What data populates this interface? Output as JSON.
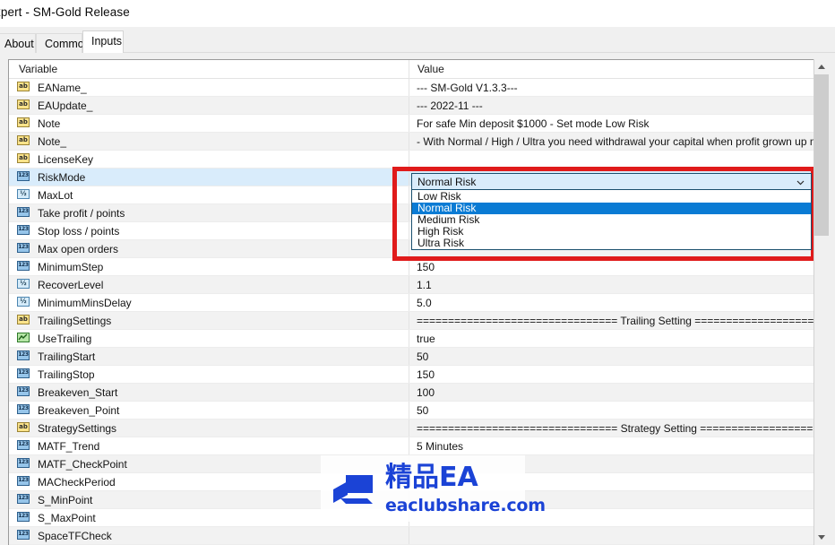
{
  "window": {
    "title": "xpert - SM-Gold Release"
  },
  "tabs": [
    {
      "label": "About",
      "active": false
    },
    {
      "label": "Common",
      "active": false
    },
    {
      "label": "Inputs",
      "active": true
    }
  ],
  "grid": {
    "columns": {
      "variable": "Variable",
      "value": "Value"
    },
    "rows": [
      {
        "icon": "string-icon",
        "type": "str",
        "name": "EAName_",
        "value": "--- SM-Gold V1.3.3---",
        "style": "plain"
      },
      {
        "icon": "string-icon",
        "type": "str",
        "name": "EAUpdate_",
        "value": "--- 2022-11 ---",
        "style": "alt"
      },
      {
        "icon": "string-icon",
        "type": "str",
        "name": "Note",
        "value": "For safe Min deposit $1000 - Set mode Low Risk",
        "style": "plain"
      },
      {
        "icon": "string-icon",
        "type": "str",
        "name": "Note_",
        "value": "- With Normal / High / Ultra you need withdrawal your capital when profit grown up more tha...",
        "style": "alt"
      },
      {
        "icon": "string-icon",
        "type": "str",
        "name": "LicenseKey",
        "value": "",
        "style": "plain"
      },
      {
        "icon": "int-icon",
        "type": "int",
        "name": "RiskMode",
        "value": "",
        "style": "selected"
      },
      {
        "icon": "double-icon",
        "type": "dbl",
        "name": "MaxLot",
        "value": "",
        "style": "plain"
      },
      {
        "icon": "int-icon",
        "type": "int",
        "name": "Take profit / points",
        "value": "",
        "style": "alt"
      },
      {
        "icon": "int-icon",
        "type": "int",
        "name": "Stop loss / points",
        "value": "",
        "style": "plain"
      },
      {
        "icon": "int-icon",
        "type": "int",
        "name": "Max open orders",
        "value": "",
        "style": "alt"
      },
      {
        "icon": "int-icon",
        "type": "int",
        "name": "MinimumStep",
        "value": "150",
        "style": "plain"
      },
      {
        "icon": "double-icon",
        "type": "dbl",
        "name": "RecoverLevel",
        "value": "1.1",
        "style": "alt"
      },
      {
        "icon": "double-icon",
        "type": "dbl",
        "name": "MinimumMinsDelay",
        "value": "5.0",
        "style": "plain"
      },
      {
        "icon": "string-icon",
        "type": "str",
        "name": "TrailingSettings",
        "value": "================================ Trailing Setting ==============================...",
        "style": "alt"
      },
      {
        "icon": "bool-icon",
        "type": "bool",
        "name": "UseTrailing",
        "value": "true",
        "style": "plain"
      },
      {
        "icon": "int-icon",
        "type": "int",
        "name": "TrailingStart",
        "value": "50",
        "style": "alt"
      },
      {
        "icon": "int-icon",
        "type": "int",
        "name": "TrailingStop",
        "value": "150",
        "style": "plain"
      },
      {
        "icon": "int-icon",
        "type": "int",
        "name": "Breakeven_Start",
        "value": "100",
        "style": "alt"
      },
      {
        "icon": "int-icon",
        "type": "int",
        "name": "Breakeven_Point",
        "value": "50",
        "style": "plain"
      },
      {
        "icon": "string-icon",
        "type": "str",
        "name": "StrategySettings",
        "value": "================================ Strategy Setting ==============================...",
        "style": "alt"
      },
      {
        "icon": "int-icon",
        "type": "int",
        "name": "MATF_Trend",
        "value": "5 Minutes",
        "style": "plain"
      },
      {
        "icon": "int-icon",
        "type": "int",
        "name": "MATF_CheckPoint",
        "value": "",
        "style": "alt"
      },
      {
        "icon": "int-icon",
        "type": "int",
        "name": "MACheckPeriod",
        "value": "",
        "style": "plain"
      },
      {
        "icon": "int-icon",
        "type": "int",
        "name": "S_MinPoint",
        "value": "",
        "style": "alt"
      },
      {
        "icon": "int-icon",
        "type": "int",
        "name": "S_MaxPoint",
        "value": "",
        "style": "plain"
      },
      {
        "icon": "int-icon",
        "type": "int",
        "name": "SpaceTFCheck",
        "value": "",
        "style": "alt"
      }
    ]
  },
  "combo": {
    "selected_value": "Normal Risk",
    "chevron": "chevron-down-icon",
    "options": [
      {
        "label": "Low Risk",
        "selected": false
      },
      {
        "label": "Normal Risk",
        "selected": true
      },
      {
        "label": "Medium Risk",
        "selected": false
      },
      {
        "label": "High Risk",
        "selected": false
      },
      {
        "label": "Ultra Risk",
        "selected": false
      }
    ]
  },
  "highlight": {
    "color": "#e01b1b"
  },
  "scrollbar": {
    "up_arrow": "scroll-up-arrow-icon",
    "down_arrow": "scroll-down-arrow-icon"
  },
  "watermark": {
    "brand_cn": "精品EA",
    "url": "eaclubshare.com",
    "color": "#1b43d6"
  }
}
